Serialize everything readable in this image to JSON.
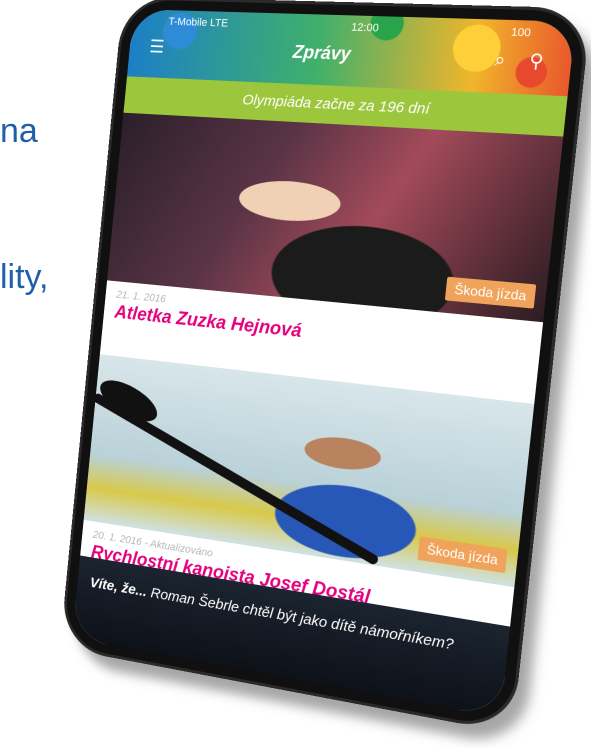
{
  "slide_text": {
    "line1": "na",
    "line2": "lity,"
  },
  "statusbar": {
    "carrier": "T-Mobile LTE",
    "time": "12:00",
    "battery": "100"
  },
  "header": {
    "title": "Zprávy",
    "menu_icon": "hamburger-icon",
    "search_icon": "search-icon",
    "filter_icon": "filter-icon"
  },
  "countdown": {
    "text": "Olympiáda začne za 196 dní"
  },
  "articles": [
    {
      "date": "21. 1. 2016",
      "title": "Atletka Zuzka Hejnová",
      "sponsor": "Škoda jízda"
    },
    {
      "date": "20. 1. 2016 - Aktualizováno",
      "title": "Rychlostní kanoista Josef Dostál",
      "sponsor": "Škoda jízda"
    }
  ],
  "banner": {
    "prefix": "Víte, že...",
    "text": "Roman Šebrle chtěl být jako dítě námořníkem?"
  },
  "colors": {
    "accent_pink": "#e5007e",
    "lime": "#9cc63b",
    "slide_blue": "#1f5fa8"
  }
}
